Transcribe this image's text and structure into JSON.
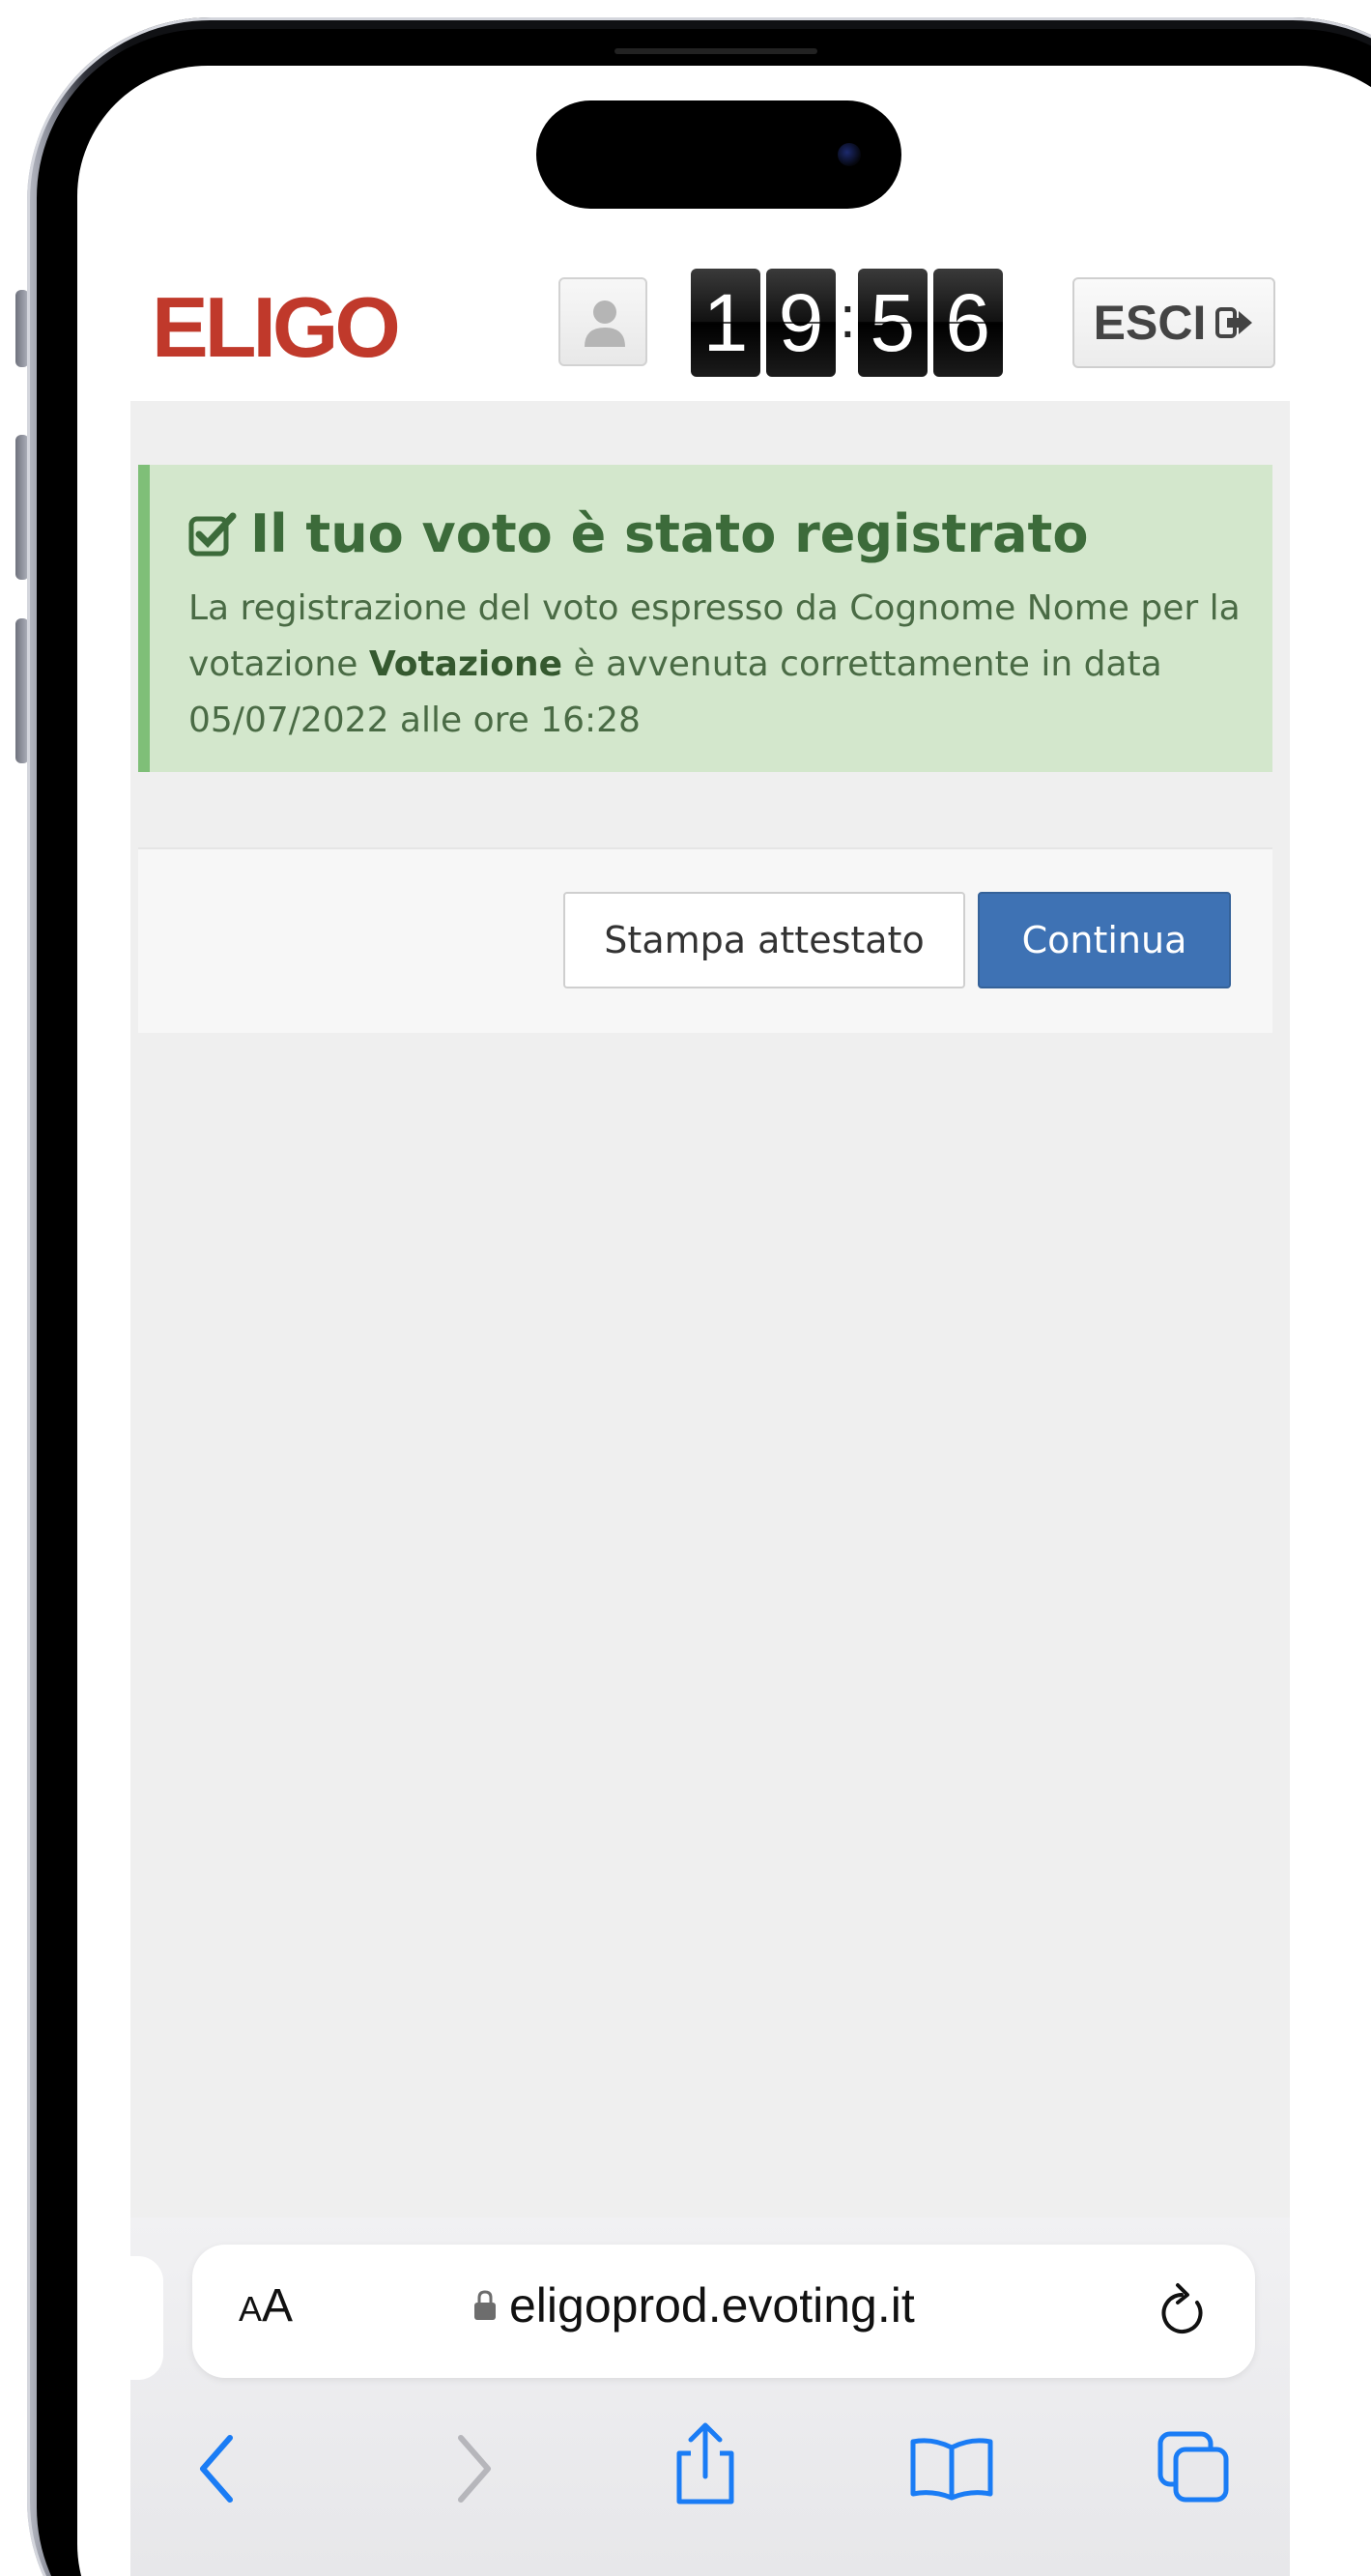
{
  "header": {
    "logo": "ELIGO",
    "clock": {
      "h1": "1",
      "h2": "9",
      "m1": "5",
      "m2": "6"
    },
    "exit_label": "ESCI"
  },
  "alert": {
    "title": "Il tuo voto è stato registrato",
    "text_1": "La registrazione del voto espresso da Cognome Nome per la votazione ",
    "vote_name": "Votazione",
    "text_2": " è avvenuta correttamente in data 05/07/2022 alle ore 16:28"
  },
  "actions": {
    "print_label": "Stampa attestato",
    "continue_label": "Continua"
  },
  "browser": {
    "text_size_label_small": "A",
    "text_size_label_large": "A",
    "url": "eligoprod.evoting.it"
  },
  "colors": {
    "brand": "#c0392b",
    "success_bg": "#d3e7cc",
    "success_text": "#3c6b3a",
    "primary": "#3e72b4",
    "ios_blue": "#1a7cf5"
  },
  "icons": [
    "user-icon",
    "exit-icon",
    "check-square-icon",
    "lock-icon",
    "reload-icon",
    "back-icon",
    "forward-icon",
    "share-icon",
    "bookmarks-icon",
    "tabs-icon"
  ]
}
